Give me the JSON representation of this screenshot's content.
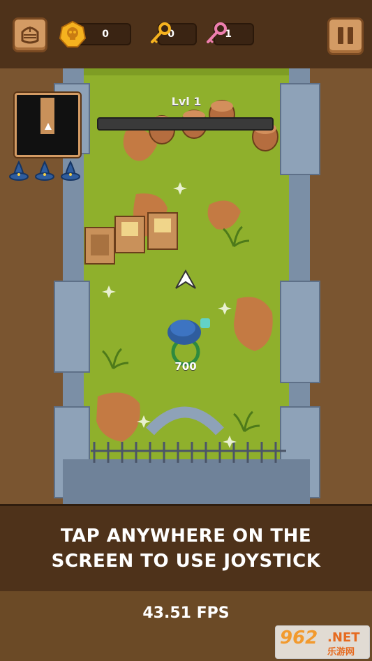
{
  "hud": {
    "coins": "0",
    "gold_keys": "0",
    "pink_keys": "1"
  },
  "level": {
    "label": "Lvl 1",
    "progress": 0
  },
  "player": {
    "score": "700"
  },
  "potions": {
    "count": 3
  },
  "tutorial": {
    "text": "TAP ANYWHERE ON THE SCREEN TO USE JOYSTICK"
  },
  "fps": {
    "label": "43.51 FPS"
  },
  "watermark": {
    "number": "962",
    "domain": ".NET",
    "chinese": "乐游网"
  },
  "icons": {
    "helmet": "knight-helmet-icon",
    "coin": "skull-coin-icon",
    "gold_key": "gold-key-icon",
    "pink_key": "pink-key-icon",
    "pause": "pause-icon",
    "potion": "blue-wizard-hat-icon"
  },
  "colors": {
    "grass": "#8fb02c",
    "dirt": "#c47a43",
    "stone": "#7b8fa6",
    "wood_panel": "#4e321a",
    "hp_bar": "#3a3a3a"
  }
}
